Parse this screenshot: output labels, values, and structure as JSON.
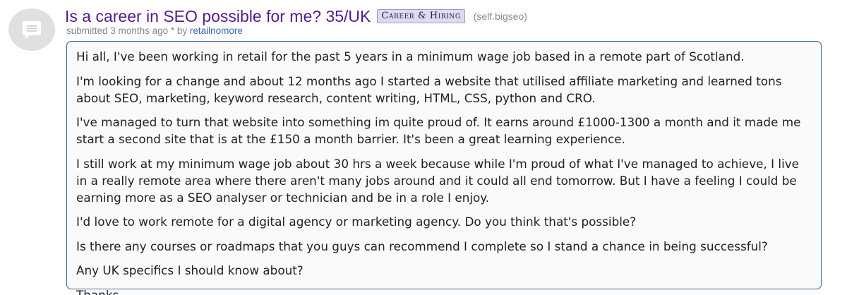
{
  "post": {
    "thumbnail_icon": "text-post-icon",
    "title": "Is a career in SEO possible for me? 35/UK",
    "flair": "Career & Hiring",
    "domain_open": "(",
    "domain": "self.bigseo",
    "domain_close": ")",
    "submitted_prefix": "submitted",
    "submitted_time": "3 months ago",
    "submitted_mid": " * by ",
    "author": "retailnomore",
    "body": [
      "Hi all, I've been working in retail for the past 5 years in a minimum wage job based in a remote part of Scotland.",
      "I'm looking for a change and about 12 months ago I started a website that utilised affiliate marketing and learned tons about SEO, marketing, keyword research, content writing, HTML, CSS, python and CRO.",
      "I've managed to turn that website into something im quite proud of. It earns around £1000-1300 a month and it made me start a second site that is at the £150 a month barrier. It's been a great learning experience.",
      "I still work at my minimum wage job about 30 hrs a week because while I'm proud of what I've managed to achieve, I live in a really remote area where there aren't many jobs around and it could all end tomorrow. But I have a feeling I could be earning more as a SEO analyser or technician and be in a role I enjoy.",
      "I'd love to work remote for a digital agency or marketing agency. Do you think that's possible?",
      "Is there any courses or roadmaps that you guys can recommend I complete so I stand a chance in being successful?",
      "Any UK specifics I should know about?",
      "Thanks."
    ]
  },
  "colors": {
    "title_link": "#551a8b",
    "author_link": "#3a67b8",
    "body_border": "#336699",
    "flair_bg": "#dcdcf0"
  }
}
